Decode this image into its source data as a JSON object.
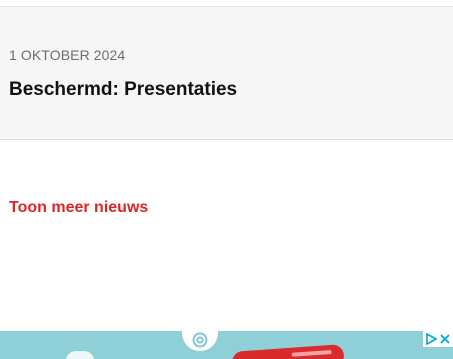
{
  "news_item": {
    "date": "1 OKTOBER 2024",
    "title": "Beschermd: Presentaties"
  },
  "more_news": {
    "label": "Toon meer nieuws"
  },
  "ad": {
    "background_color": "#8fd0d8",
    "icons": [
      "ad-logo-icon",
      "ad-info-icon",
      "close-icon"
    ]
  },
  "colors": {
    "accent": "#d62828",
    "card_background": "#f6f6f6",
    "date_text": "#6d6d6d",
    "title_text": "#111111"
  }
}
